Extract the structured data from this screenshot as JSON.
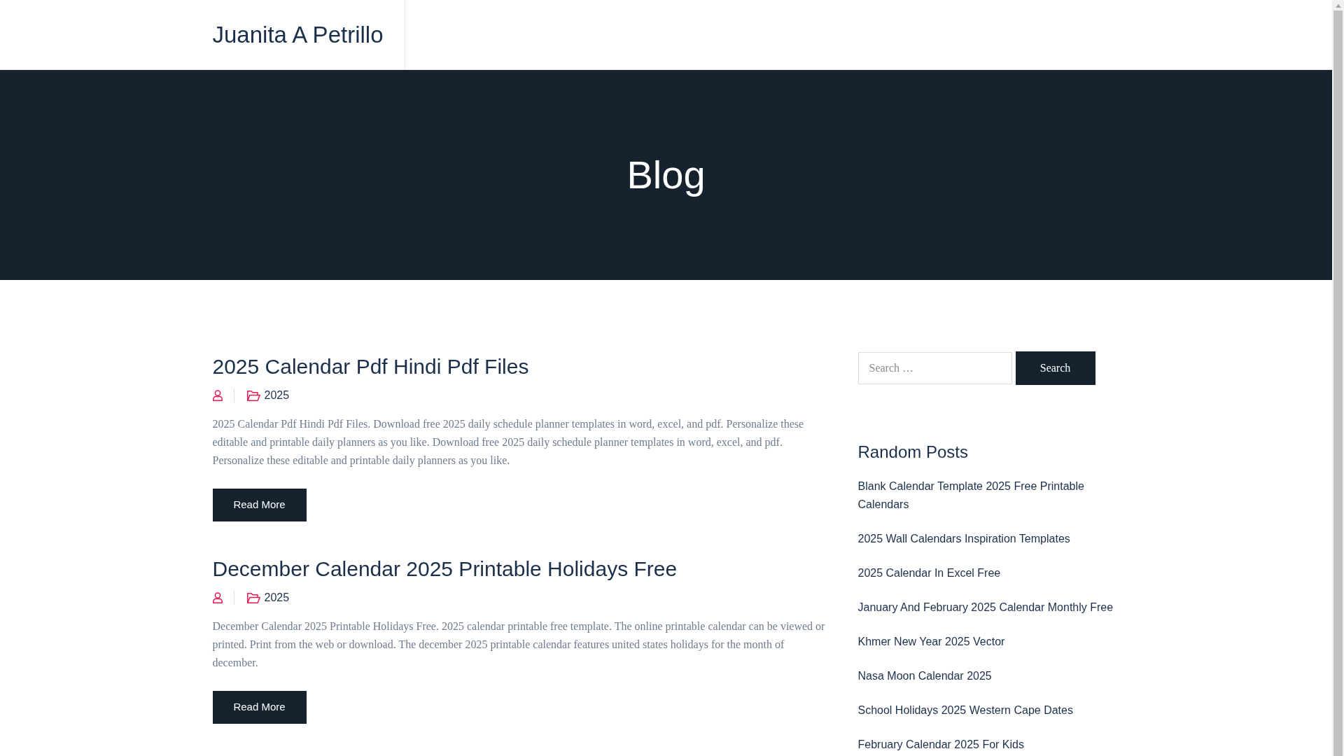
{
  "site": {
    "title": "Juanita A Petrillo"
  },
  "hero": {
    "title": "Blog"
  },
  "posts": [
    {
      "title": "2025 Calendar Pdf Hindi Pdf Files",
      "category": "2025",
      "excerpt": "2025 Calendar Pdf Hindi Pdf Files. Download free 2025 daily schedule planner templates in word, excel, and pdf. Personalize these editable and printable daily planners as you like. Download free 2025 daily schedule planner templates in word, excel, and pdf. Personalize these editable and printable daily planners as you like.",
      "button": "Read More"
    },
    {
      "title": "December Calendar 2025 Printable Holidays Free",
      "category": "2025",
      "excerpt": "December Calendar 2025 Printable Holidays Free. 2025 calendar printable free template. The online printable calendar can be viewed or printed. Print from the web or download. The december 2025 printable calendar features united states holidays for the month of december.",
      "button": "Read More"
    }
  ],
  "sidebar": {
    "search": {
      "placeholder": "Search …",
      "button": "Search"
    },
    "random_posts": {
      "title": "Random Posts",
      "items": [
        "Blank Calendar Template 2025 Free Printable Calendars",
        "2025 Wall Calendars Inspiration Templates",
        "2025 Calendar In Excel Free",
        "January And February 2025 Calendar Monthly Free",
        "Khmer New Year 2025 Vector",
        "Nasa Moon Calendar 2025",
        "School Holidays 2025 Western Cape Dates",
        "February Calendar 2025 For Kids"
      ]
    }
  }
}
